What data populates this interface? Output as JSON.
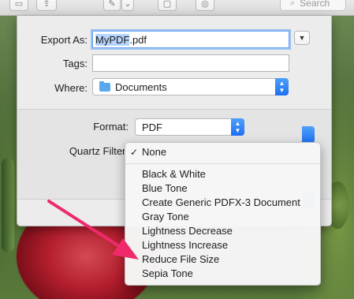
{
  "export_dialog": {
    "export_as_label": "Export As:",
    "filename_selected": "MyPDF",
    "filename_ext": ".pdf",
    "tags_label": "Tags:",
    "tags_value": "",
    "where_label": "Where:",
    "where_value": "Documents",
    "format_label": "Format:",
    "format_value": "PDF",
    "quartz_filter_label": "Quartz Filter:"
  },
  "toolbar": {
    "search_placeholder": "Search"
  },
  "quartz_menu": {
    "checked_item": "None",
    "items": [
      "Black & White",
      "Blue Tone",
      "Create Generic PDFX-3 Document",
      "Gray Tone",
      "Lightness Decrease",
      "Lightness Increase",
      "Reduce File Size",
      "Sepia Tone"
    ]
  },
  "colors": {
    "accent_blue": "#1b6ff3",
    "selection_highlight": "#b5d5fd",
    "annotation_arrow": "#ee2a6b"
  }
}
